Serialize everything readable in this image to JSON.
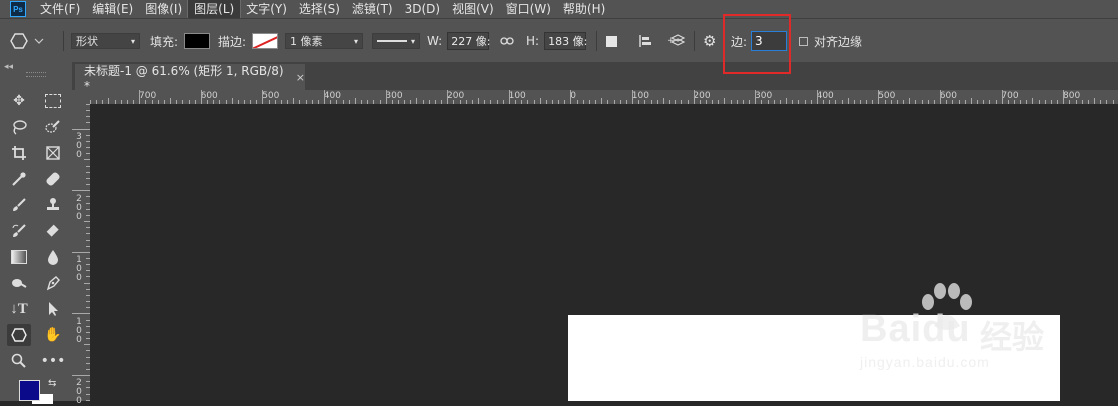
{
  "app": {
    "logo": "Ps"
  },
  "menu": {
    "items": [
      "文件(F)",
      "编辑(E)",
      "图像(I)",
      "图层(L)",
      "文字(Y)",
      "选择(S)",
      "滤镜(T)",
      "3D(D)",
      "视图(V)",
      "窗口(W)",
      "帮助(H)"
    ],
    "active_index": 3
  },
  "options": {
    "mode_value": "形状",
    "fill_label": "填充:",
    "fill_color": "#000000",
    "stroke_label": "描边:",
    "stroke_width": "1 像素",
    "w_label": "W:",
    "w_value": "227 像:",
    "h_label": "H:",
    "h_value": "183 像:",
    "sides_label": "边:",
    "sides_value": "3",
    "align_edges_label": "对齐边缘",
    "highlight_color": "#e02a2a"
  },
  "document": {
    "tab_title": "未标题-1 @ 61.6% (矩形 1, RGB/8) *",
    "close_symbol": "×"
  },
  "ruler": {
    "h_labels": [
      "700",
      "600",
      "500",
      "400",
      "300",
      "200",
      "100",
      "0",
      "100",
      "200",
      "300",
      "400",
      "500",
      "600",
      "700",
      "800"
    ],
    "v_labels": [
      "3\n0\n0",
      "2\n0\n0",
      "1\n0\n0",
      "1\n0\n0",
      "2\n0\n0"
    ]
  },
  "colors": {
    "foreground": "#0a0a8a",
    "background": "#ffffff",
    "canvas_bg": "#282828"
  },
  "watermark": {
    "brand": "Baidu",
    "brand_cn": "经验",
    "url": "jingyan.baidu.com"
  },
  "icons": [
    "ps-logo-icon",
    "polygon-icon",
    "chevron-down-icon",
    "link-icon",
    "gear-icon",
    "move-icon",
    "marquee-icon",
    "lasso-icon",
    "quick-select-icon",
    "crop-icon",
    "frame-icon",
    "eyedropper-icon",
    "healing-icon",
    "brush-icon",
    "stamp-icon",
    "history-brush-icon",
    "eraser-icon",
    "gradient-icon",
    "blur-icon",
    "dodge-icon",
    "pen-icon",
    "type-icon",
    "path-select-icon",
    "polygon-tool-icon",
    "hand-icon",
    "zoom-icon",
    "more-icon",
    "swap-colors-icon"
  ]
}
